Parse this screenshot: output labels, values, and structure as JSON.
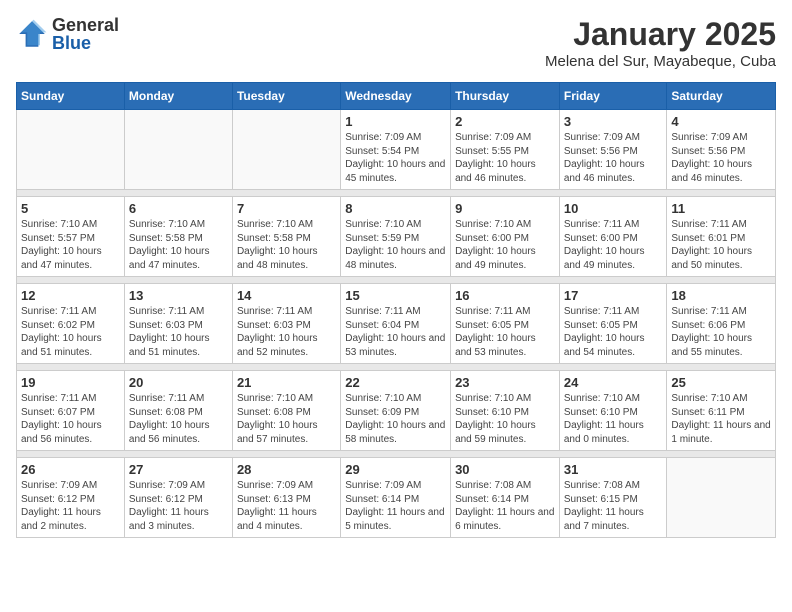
{
  "header": {
    "logo_general": "General",
    "logo_blue": "Blue",
    "month_year": "January 2025",
    "location": "Melena del Sur, Mayabeque, Cuba"
  },
  "weekdays": [
    "Sunday",
    "Monday",
    "Tuesday",
    "Wednesday",
    "Thursday",
    "Friday",
    "Saturday"
  ],
  "weeks": [
    [
      {
        "day": "",
        "sunrise": "",
        "sunset": "",
        "daylight": ""
      },
      {
        "day": "",
        "sunrise": "",
        "sunset": "",
        "daylight": ""
      },
      {
        "day": "",
        "sunrise": "",
        "sunset": "",
        "daylight": ""
      },
      {
        "day": "1",
        "sunrise": "Sunrise: 7:09 AM",
        "sunset": "Sunset: 5:54 PM",
        "daylight": "Daylight: 10 hours and 45 minutes."
      },
      {
        "day": "2",
        "sunrise": "Sunrise: 7:09 AM",
        "sunset": "Sunset: 5:55 PM",
        "daylight": "Daylight: 10 hours and 46 minutes."
      },
      {
        "day": "3",
        "sunrise": "Sunrise: 7:09 AM",
        "sunset": "Sunset: 5:56 PM",
        "daylight": "Daylight: 10 hours and 46 minutes."
      },
      {
        "day": "4",
        "sunrise": "Sunrise: 7:09 AM",
        "sunset": "Sunset: 5:56 PM",
        "daylight": "Daylight: 10 hours and 46 minutes."
      }
    ],
    [
      {
        "day": "5",
        "sunrise": "Sunrise: 7:10 AM",
        "sunset": "Sunset: 5:57 PM",
        "daylight": "Daylight: 10 hours and 47 minutes."
      },
      {
        "day": "6",
        "sunrise": "Sunrise: 7:10 AM",
        "sunset": "Sunset: 5:58 PM",
        "daylight": "Daylight: 10 hours and 47 minutes."
      },
      {
        "day": "7",
        "sunrise": "Sunrise: 7:10 AM",
        "sunset": "Sunset: 5:58 PM",
        "daylight": "Daylight: 10 hours and 48 minutes."
      },
      {
        "day": "8",
        "sunrise": "Sunrise: 7:10 AM",
        "sunset": "Sunset: 5:59 PM",
        "daylight": "Daylight: 10 hours and 48 minutes."
      },
      {
        "day": "9",
        "sunrise": "Sunrise: 7:10 AM",
        "sunset": "Sunset: 6:00 PM",
        "daylight": "Daylight: 10 hours and 49 minutes."
      },
      {
        "day": "10",
        "sunrise": "Sunrise: 7:11 AM",
        "sunset": "Sunset: 6:00 PM",
        "daylight": "Daylight: 10 hours and 49 minutes."
      },
      {
        "day": "11",
        "sunrise": "Sunrise: 7:11 AM",
        "sunset": "Sunset: 6:01 PM",
        "daylight": "Daylight: 10 hours and 50 minutes."
      }
    ],
    [
      {
        "day": "12",
        "sunrise": "Sunrise: 7:11 AM",
        "sunset": "Sunset: 6:02 PM",
        "daylight": "Daylight: 10 hours and 51 minutes."
      },
      {
        "day": "13",
        "sunrise": "Sunrise: 7:11 AM",
        "sunset": "Sunset: 6:03 PM",
        "daylight": "Daylight: 10 hours and 51 minutes."
      },
      {
        "day": "14",
        "sunrise": "Sunrise: 7:11 AM",
        "sunset": "Sunset: 6:03 PM",
        "daylight": "Daylight: 10 hours and 52 minutes."
      },
      {
        "day": "15",
        "sunrise": "Sunrise: 7:11 AM",
        "sunset": "Sunset: 6:04 PM",
        "daylight": "Daylight: 10 hours and 53 minutes."
      },
      {
        "day": "16",
        "sunrise": "Sunrise: 7:11 AM",
        "sunset": "Sunset: 6:05 PM",
        "daylight": "Daylight: 10 hours and 53 minutes."
      },
      {
        "day": "17",
        "sunrise": "Sunrise: 7:11 AM",
        "sunset": "Sunset: 6:05 PM",
        "daylight": "Daylight: 10 hours and 54 minutes."
      },
      {
        "day": "18",
        "sunrise": "Sunrise: 7:11 AM",
        "sunset": "Sunset: 6:06 PM",
        "daylight": "Daylight: 10 hours and 55 minutes."
      }
    ],
    [
      {
        "day": "19",
        "sunrise": "Sunrise: 7:11 AM",
        "sunset": "Sunset: 6:07 PM",
        "daylight": "Daylight: 10 hours and 56 minutes."
      },
      {
        "day": "20",
        "sunrise": "Sunrise: 7:11 AM",
        "sunset": "Sunset: 6:08 PM",
        "daylight": "Daylight: 10 hours and 56 minutes."
      },
      {
        "day": "21",
        "sunrise": "Sunrise: 7:10 AM",
        "sunset": "Sunset: 6:08 PM",
        "daylight": "Daylight: 10 hours and 57 minutes."
      },
      {
        "day": "22",
        "sunrise": "Sunrise: 7:10 AM",
        "sunset": "Sunset: 6:09 PM",
        "daylight": "Daylight: 10 hours and 58 minutes."
      },
      {
        "day": "23",
        "sunrise": "Sunrise: 7:10 AM",
        "sunset": "Sunset: 6:10 PM",
        "daylight": "Daylight: 10 hours and 59 minutes."
      },
      {
        "day": "24",
        "sunrise": "Sunrise: 7:10 AM",
        "sunset": "Sunset: 6:10 PM",
        "daylight": "Daylight: 11 hours and 0 minutes."
      },
      {
        "day": "25",
        "sunrise": "Sunrise: 7:10 AM",
        "sunset": "Sunset: 6:11 PM",
        "daylight": "Daylight: 11 hours and 1 minute."
      }
    ],
    [
      {
        "day": "26",
        "sunrise": "Sunrise: 7:09 AM",
        "sunset": "Sunset: 6:12 PM",
        "daylight": "Daylight: 11 hours and 2 minutes."
      },
      {
        "day": "27",
        "sunrise": "Sunrise: 7:09 AM",
        "sunset": "Sunset: 6:12 PM",
        "daylight": "Daylight: 11 hours and 3 minutes."
      },
      {
        "day": "28",
        "sunrise": "Sunrise: 7:09 AM",
        "sunset": "Sunset: 6:13 PM",
        "daylight": "Daylight: 11 hours and 4 minutes."
      },
      {
        "day": "29",
        "sunrise": "Sunrise: 7:09 AM",
        "sunset": "Sunset: 6:14 PM",
        "daylight": "Daylight: 11 hours and 5 minutes."
      },
      {
        "day": "30",
        "sunrise": "Sunrise: 7:08 AM",
        "sunset": "Sunset: 6:14 PM",
        "daylight": "Daylight: 11 hours and 6 minutes."
      },
      {
        "day": "31",
        "sunrise": "Sunrise: 7:08 AM",
        "sunset": "Sunset: 6:15 PM",
        "daylight": "Daylight: 11 hours and 7 minutes."
      },
      {
        "day": "",
        "sunrise": "",
        "sunset": "",
        "daylight": ""
      }
    ]
  ]
}
